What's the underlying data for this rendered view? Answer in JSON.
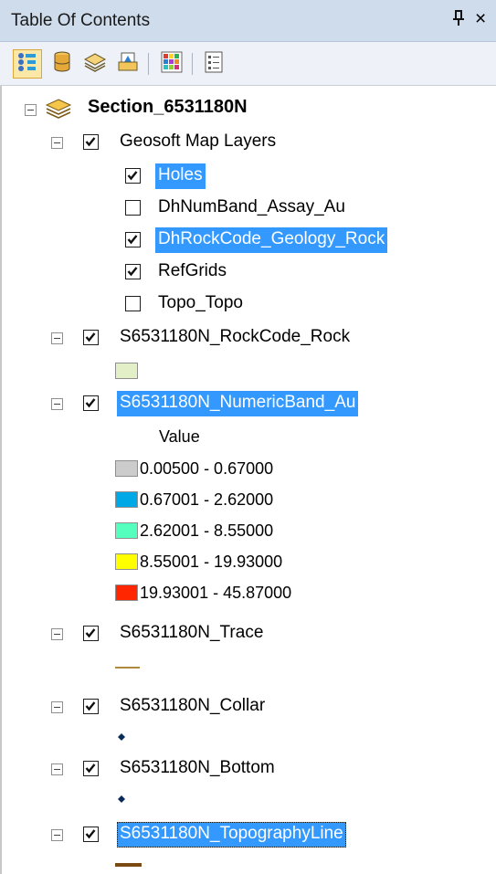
{
  "panel": {
    "title": "Table Of Contents",
    "pin_glyph": "q",
    "close_glyph": "×"
  },
  "toolbar": {
    "buttons": [
      {
        "name": "list-by-drawing-order",
        "icon": "list-by-drawing-order-icon"
      },
      {
        "name": "list-by-source",
        "icon": "database-icon"
      },
      {
        "name": "list-by-visibility",
        "icon": "layers-icon"
      },
      {
        "name": "list-by-selection",
        "icon": "selection-icon"
      },
      {
        "name": "layer-colors",
        "icon": "color-grid-icon"
      },
      {
        "name": "options",
        "icon": "options-list-icon"
      }
    ]
  },
  "tree": {
    "data_frame": {
      "label": "Section_6531180N"
    },
    "group": {
      "label": "Geosoft Map Layers",
      "checked": true
    },
    "group_layers": [
      {
        "label": "Holes",
        "checked": true,
        "selected": true
      },
      {
        "label": "DhNumBand_Assay_Au",
        "checked": false,
        "selected": false
      },
      {
        "label": "DhRockCode_Geology_Rock",
        "checked": true,
        "selected": true
      },
      {
        "label": "RefGrids",
        "checked": true,
        "selected": false
      },
      {
        "label": "Topo_Topo",
        "checked": false,
        "selected": false
      }
    ],
    "rockcode_layer": {
      "label": "S6531180N_RockCode_Rock",
      "checked": true,
      "symbol_color": "#e3f0c7"
    },
    "numeric_layer": {
      "label": "S6531180N_NumericBand_Au",
      "checked": true,
      "selected": true,
      "field_heading": "Value",
      "classes": [
        {
          "range": "0.00500 - 0.67000",
          "color": "#cccccc"
        },
        {
          "range": "0.67001 - 2.62000",
          "color": "#00a9e6"
        },
        {
          "range": "2.62001 - 8.55000",
          "color": "#55ffbe"
        },
        {
          "range": "8.55001 - 19.93000",
          "color": "#ffff00"
        },
        {
          "range": "19.93001 - 45.87000",
          "color": "#ff2600"
        }
      ]
    },
    "trace_layer": {
      "label": "S6531180N_Trace",
      "checked": true,
      "symbol_color": "#b08a3c"
    },
    "collar_layer": {
      "label": "S6531180N_Collar",
      "checked": true,
      "symbol_color": "#0b2a5c"
    },
    "bottom_layer": {
      "label": "S6531180N_Bottom",
      "checked": true,
      "symbol_color": "#0b2a5c"
    },
    "topo_layer": {
      "label": "S6531180N_TopographyLine",
      "checked": true,
      "selected": true,
      "symbol_color": "#7a4a12"
    }
  }
}
